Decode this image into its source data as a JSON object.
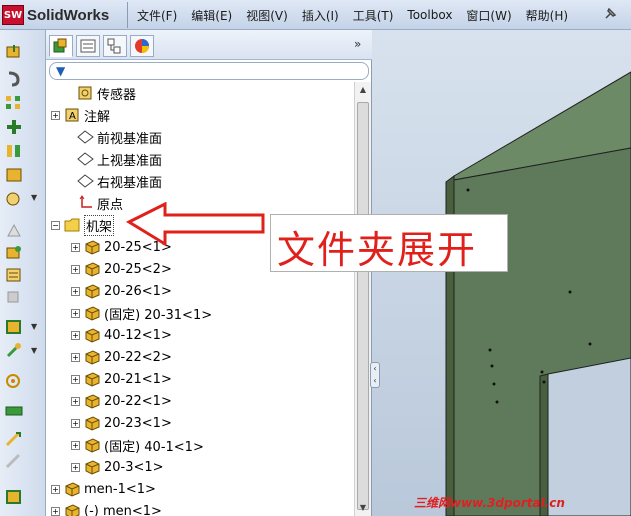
{
  "app": {
    "logo_mark": "SW",
    "name": "SolidWorks"
  },
  "menu": [
    "文件(F)",
    "编辑(E)",
    "视图(V)",
    "插入(I)",
    "工具(T)",
    "Toolbox",
    "窗口(W)",
    "帮助(H)"
  ],
  "panel": {
    "collapse": "»",
    "filter_icon": "funnel-icon"
  },
  "tree": {
    "items": [
      {
        "label": "传感器",
        "icon": "sensor-icon"
      },
      {
        "label": "注解",
        "icon": "annotation-icon"
      },
      {
        "label": "前视基准面",
        "icon": "plane-icon"
      },
      {
        "label": "上视基准面",
        "icon": "plane-icon"
      },
      {
        "label": "右视基准面",
        "icon": "plane-icon"
      },
      {
        "label": "原点",
        "icon": "origin-icon"
      },
      {
        "label": "机架",
        "icon": "folder-icon"
      },
      {
        "label": "20-25<1>",
        "icon": "part-icon"
      },
      {
        "label": "20-25<2>",
        "icon": "part-icon"
      },
      {
        "label": "20-26<1>",
        "icon": "part-icon"
      },
      {
        "label": "(固定) 20-31<1>",
        "icon": "part-icon"
      },
      {
        "label": "40-12<1>",
        "icon": "part-icon"
      },
      {
        "label": "20-22<2>",
        "icon": "part-icon"
      },
      {
        "label": "20-21<1>",
        "icon": "part-icon"
      },
      {
        "label": "20-22<1>",
        "icon": "part-icon"
      },
      {
        "label": "20-23<1>",
        "icon": "part-icon"
      },
      {
        "label": "(固定) 40-1<1>",
        "icon": "part-icon"
      },
      {
        "label": "20-3<1>",
        "icon": "part-icon"
      },
      {
        "label": "men-1<1>",
        "icon": "part-icon"
      },
      {
        "label": "(-) men<1>",
        "icon": "part-icon"
      }
    ]
  },
  "callout": {
    "text": "文件夹展开"
  },
  "watermark": "三维网www.3dportal.cn",
  "colors": {
    "model_green": "#5f7a5a",
    "callout_red": "#e0201b"
  }
}
